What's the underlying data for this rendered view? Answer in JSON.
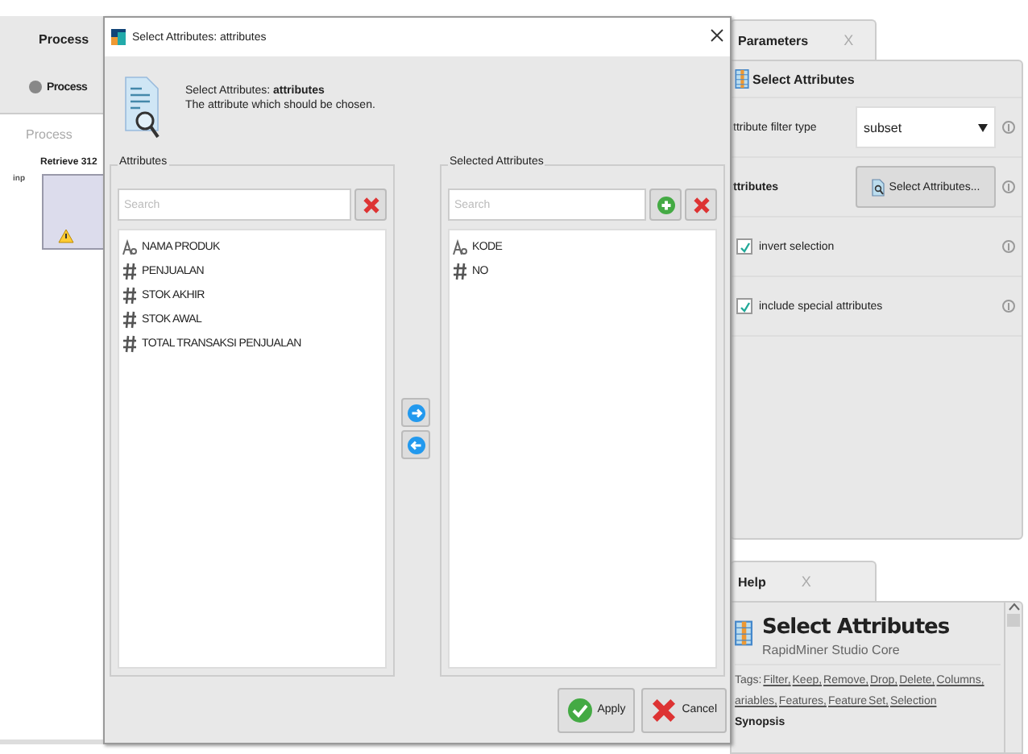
{
  "process_panel": {
    "tab": "Process",
    "breadcrumb": "Process",
    "canvas_label": "Process",
    "operator": {
      "name": "Retrieve 312",
      "port": "inp"
    }
  },
  "dialog": {
    "title": "Select Attributes: attributes",
    "heading": "Select Attributes: **attributes**",
    "description": "The attribute which should be chosen.",
    "available": {
      "legend": "Attributes",
      "placeholder": "Search",
      "items": [
        {
          "name": "NAMA PRODUK",
          "kind": "nominal"
        },
        {
          "name": "PENJUALAN",
          "kind": "numeric"
        },
        {
          "name": "STOK AKHIR",
          "kind": "numeric"
        },
        {
          "name": "STOK AWAL",
          "kind": "numeric"
        },
        {
          "name": "TOTAL TRANSAKSI PENJUALAN",
          "kind": "numeric"
        }
      ]
    },
    "selected": {
      "legend": "Selected Attributes",
      "placeholder": "Search",
      "items": [
        {
          "name": "KODE",
          "kind": "nominal"
        },
        {
          "name": "NO",
          "kind": "numeric"
        }
      ]
    },
    "buttons": [
      {
        "label": "Apply",
        "kind": "apply"
      },
      {
        "label": "Cancel",
        "kind": "cancel"
      }
    ]
  },
  "parameters": {
    "tab": "Parameters",
    "close": "X",
    "operator": "Select Attributes",
    "rows": [
      {
        "kind": "dropdown",
        "label": "ttribute filter type",
        "value": "subset"
      },
      {
        "kind": "button",
        "label": "ttributes",
        "value": "Select Attributes..."
      },
      {
        "kind": "checkbox",
        "label": "invert selection",
        "checked": true
      },
      {
        "kind": "checkbox",
        "label": "include special attributes",
        "checked": true
      }
    ]
  },
  "help": {
    "tab": "Help",
    "close": "X",
    "title": "Select Attributes",
    "subtitle": "RapidMiner Studio Core",
    "tags_label": "Tags:",
    "tags": [
      "Filter,",
      "Keep,",
      "Remove,",
      "Drop,",
      "Delete,",
      "Columns,",
      "ariables,",
      "Features,",
      "Feature Set,",
      "Selection"
    ],
    "section": "Synopsis"
  }
}
